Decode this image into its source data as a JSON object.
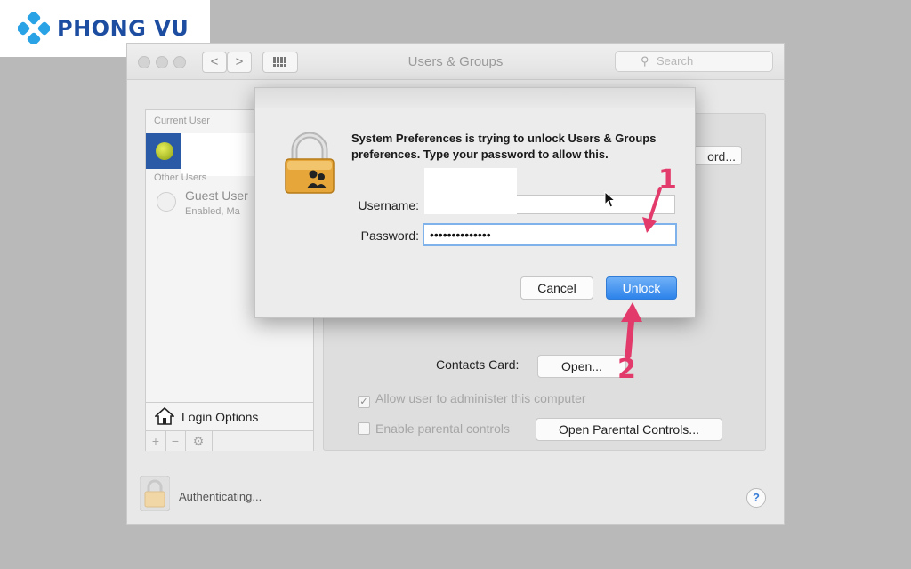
{
  "watermark": {
    "brand": "PHONG VU"
  },
  "window": {
    "title": "Users & Groups",
    "search_placeholder": "Search",
    "nav": {
      "back": "<",
      "forward": ">"
    }
  },
  "sidebar": {
    "current_user_header": "Current User",
    "other_users_header": "Other Users",
    "guest_name": "Guest User",
    "guest_status": "Enabled, Ma",
    "login_options": "Login Options",
    "add": "+",
    "remove": "−",
    "gear": "⚙"
  },
  "panel": {
    "password_btn_partial": "ord...",
    "contacts_label": "Contacts Card:",
    "open_btn": "Open...",
    "allow_admin_label": "Allow user to administer this computer",
    "allow_admin_checked": true,
    "parental_label": "Enable parental controls",
    "parental_checked": false,
    "parental_btn": "Open Parental Controls..."
  },
  "status": {
    "auth_text": "Authenticating...",
    "help": "?"
  },
  "dialog": {
    "message": "System Preferences is trying to unlock Users & Groups preferences. Type your password to allow this.",
    "username_label": "Username:",
    "username_value": "",
    "password_label": "Password:",
    "password_value": "••••••••••••••",
    "cancel": "Cancel",
    "unlock": "Unlock"
  },
  "annotations": {
    "step1": "1",
    "step2": "2"
  },
  "colors": {
    "accent_blue": "#2d83ea",
    "annotation_pink": "#e23b6b",
    "brand_blue": "#1d4da1"
  }
}
